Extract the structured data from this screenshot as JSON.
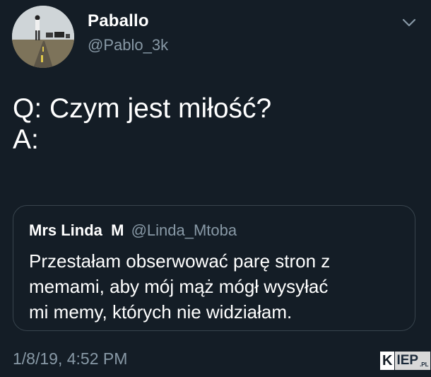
{
  "tweet": {
    "author": {
      "name": "Paballo",
      "handle": "@Pablo_3k"
    },
    "text_lines": [
      "Q: Czym jest miłość?",
      "A:"
    ],
    "quoted": {
      "name": "Mrs Linda  M",
      "handle": "@Linda_Mtoba",
      "body_lines": [
        "Przestałam obserwować parę stron z",
        "memami, aby mój mąż mógł wysyłać",
        "mi memy, których nie widziałam."
      ]
    },
    "timestamp": "1/8/19, 4:52 PM"
  },
  "watermark": {
    "part1": "K",
    "part2": "IEP",
    "suffix": ".PL"
  },
  "icons": {
    "menu": "chevron-down-icon"
  },
  "colors": {
    "background": "#141d26",
    "text": "#ffffff",
    "secondary_text": "#8899a6",
    "border": "#38444d"
  }
}
